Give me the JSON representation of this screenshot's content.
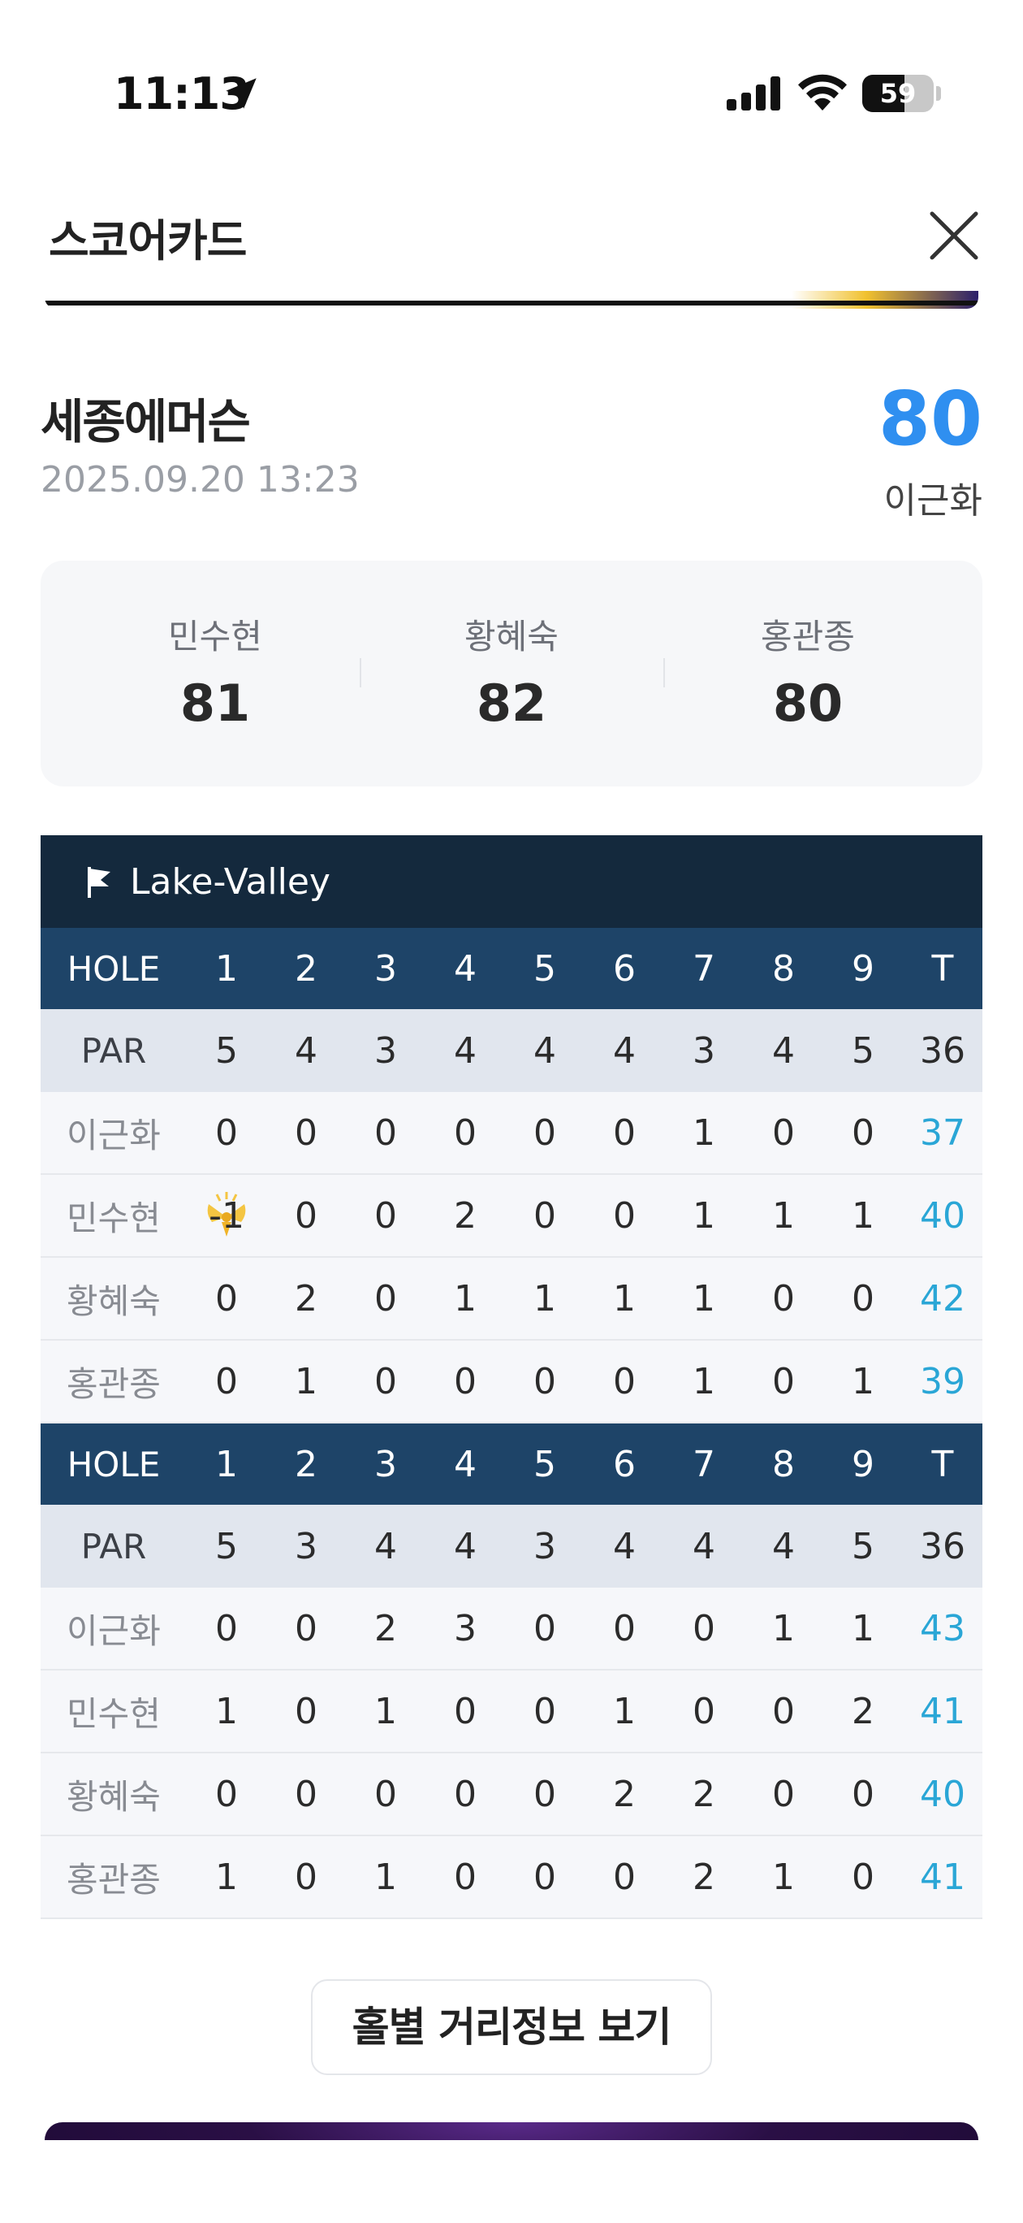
{
  "status": {
    "time": "11:13",
    "battery": "59",
    "battery_level": 0.59
  },
  "header": {
    "title": "스코어카드"
  },
  "round": {
    "course": "세종에머슨",
    "datetime": "2025.09.20 13:23",
    "winner_score": "80",
    "winner_name": "이근화"
  },
  "others": [
    {
      "name": "민수현",
      "score": "81"
    },
    {
      "name": "황혜숙",
      "score": "82"
    },
    {
      "name": "홍관종",
      "score": "80"
    }
  ],
  "scorecard": {
    "course": "Lake-Valley",
    "hole_label": "HOLE",
    "par_label": "PAR",
    "sections": [
      {
        "holes": [
          "1",
          "2",
          "3",
          "4",
          "5",
          "6",
          "7",
          "8",
          "9",
          "T"
        ],
        "par": [
          "5",
          "4",
          "3",
          "4",
          "4",
          "4",
          "3",
          "4",
          "5",
          "36"
        ],
        "players": [
          {
            "name": "이근화",
            "scores": [
              "0",
              "0",
              "0",
              "0",
              "0",
              "0",
              "1",
              "0",
              "0"
            ],
            "total": "37"
          },
          {
            "name": "민수현",
            "scores": [
              "-1",
              "0",
              "0",
              "2",
              "0",
              "0",
              "1",
              "1",
              "1"
            ],
            "total": "40"
          },
          {
            "name": "황혜숙",
            "scores": [
              "0",
              "2",
              "0",
              "1",
              "1",
              "1",
              "1",
              "0",
              "0"
            ],
            "total": "42"
          },
          {
            "name": "홍관종",
            "scores": [
              "0",
              "1",
              "0",
              "0",
              "0",
              "0",
              "1",
              "0",
              "1"
            ],
            "total": "39"
          }
        ]
      },
      {
        "holes": [
          "1",
          "2",
          "3",
          "4",
          "5",
          "6",
          "7",
          "8",
          "9",
          "T"
        ],
        "par": [
          "5",
          "3",
          "4",
          "4",
          "3",
          "4",
          "4",
          "4",
          "5",
          "36"
        ],
        "players": [
          {
            "name": "이근화",
            "scores": [
              "0",
              "0",
              "2",
              "3",
              "0",
              "0",
              "0",
              "1",
              "1"
            ],
            "total": "43"
          },
          {
            "name": "민수현",
            "scores": [
              "1",
              "0",
              "1",
              "0",
              "0",
              "1",
              "0",
              "0",
              "2"
            ],
            "total": "41"
          },
          {
            "name": "황혜숙",
            "scores": [
              "0",
              "0",
              "0",
              "0",
              "0",
              "2",
              "2",
              "0",
              "0"
            ],
            "total": "40"
          },
          {
            "name": "홍관종",
            "scores": [
              "1",
              "0",
              "1",
              "0",
              "0",
              "0",
              "2",
              "1",
              "0"
            ],
            "total": "41"
          }
        ]
      }
    ]
  },
  "actions": {
    "distance_button": "홀별 거리정보 보기"
  },
  "colors": {
    "accent": "#2f8ff0",
    "total": "#2aa6d6",
    "course_bar": "#14293d",
    "hole_row": "#1e4468"
  }
}
